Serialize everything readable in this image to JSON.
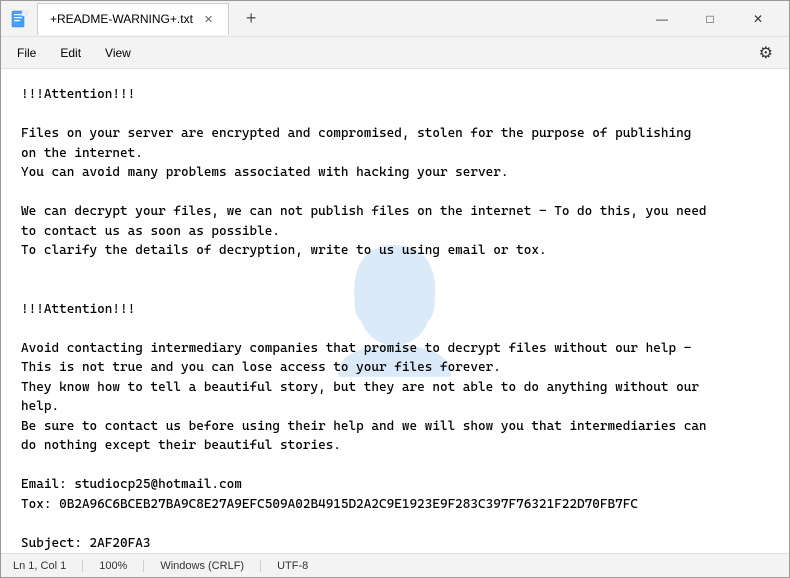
{
  "window": {
    "title": "+README-WARNING+.txt",
    "app_icon": "📄"
  },
  "tabs": [
    {
      "label": "+README-WARNING+.txt",
      "active": true
    }
  ],
  "tab_add_label": "+",
  "controls": {
    "minimize": "—",
    "maximize": "□",
    "close": "✕"
  },
  "menu": {
    "items": [
      "File",
      "Edit",
      "View"
    ],
    "settings_icon": "⚙"
  },
  "content": {
    "text": "!!!Attention!!!\n\nFiles on your server are encrypted and compromised, stolen for the purpose of publishing\non the internet.\nYou can avoid many problems associated with hacking your server.\n\nWe can decrypt your files, we can not publish files on the internet - To do this, you need\nto contact us as soon as possible.\nTo clarify the details of decryption, write to us using email or tox.\n\n\n!!!Attention!!!\n\nAvoid contacting intermediary companies that promise to decrypt files without our help -\nThis is not true and you can lose access to your files forever.\nThey know how to tell a beautiful story, but they are not able to do anything without our\nhelp.\nBe sure to contact us before using their help and we will show you that intermediaries can\ndo nothing except their beautiful stories.\n\nEmail: studiocp25@hotmail.com\nTox: 0B2A96C6BCEB27BA9C8E27A9EFC509A02B4915D2A2C9E1923E9F283C397F76321F22D70FB7FC\n\nSubject: 2AF20FA3",
    "watermark": "👤"
  },
  "status_bar": {
    "position": "Ln 1, Col 1",
    "zoom": "100%",
    "line_ending": "Windows (CRLF)",
    "encoding": "UTF-8"
  }
}
